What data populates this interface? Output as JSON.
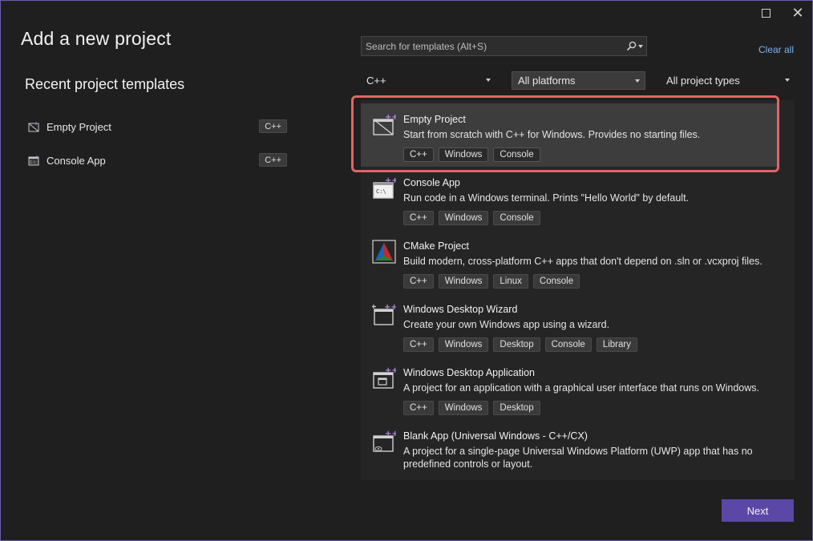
{
  "window": {
    "title": "Add a new project"
  },
  "recent": {
    "heading": "Recent project templates",
    "items": [
      {
        "label": "Empty Project",
        "tag": "C++",
        "icon": "empty-project-icon"
      },
      {
        "label": "Console App",
        "tag": "C++",
        "icon": "console-app-icon"
      }
    ]
  },
  "search": {
    "placeholder": "Search for templates (Alt+S)",
    "value": ""
  },
  "clear_all": "Clear all",
  "filters": {
    "language": "C++",
    "platform": "All platforms",
    "project_type": "All project types"
  },
  "templates": [
    {
      "name": "Empty Project",
      "desc": "Start from scratch with C++ for Windows. Provides no starting files.",
      "tags": [
        "C++",
        "Windows",
        "Console"
      ],
      "icon": "empty-project-icon",
      "selected": true
    },
    {
      "name": "Console App",
      "desc": "Run code in a Windows terminal. Prints \"Hello World\" by default.",
      "tags": [
        "C++",
        "Windows",
        "Console"
      ],
      "icon": "console-app-icon"
    },
    {
      "name": "CMake Project",
      "desc": "Build modern, cross-platform C++ apps that don't depend on .sln or .vcxproj files.",
      "tags": [
        "C++",
        "Windows",
        "Linux",
        "Console"
      ],
      "icon": "cmake-icon"
    },
    {
      "name": "Windows Desktop Wizard",
      "desc": "Create your own Windows app using a wizard.",
      "tags": [
        "C++",
        "Windows",
        "Desktop",
        "Console",
        "Library"
      ],
      "icon": "wizard-icon"
    },
    {
      "name": "Windows Desktop Application",
      "desc": "A project for an application with a graphical user interface that runs on Windows.",
      "tags": [
        "C++",
        "Windows",
        "Desktop"
      ],
      "icon": "desktop-app-icon"
    },
    {
      "name": "Blank App (Universal Windows - C++/CX)",
      "desc": "A project for a single-page Universal Windows Platform (UWP) app that has no predefined controls or layout.",
      "tags": [],
      "icon": "uwp-app-icon"
    }
  ],
  "next_label": "Next",
  "colors": {
    "accent": "#5b47a6",
    "highlight": "#e46465",
    "link": "#7fb1ef",
    "plus_badge": "#b48ee0"
  }
}
